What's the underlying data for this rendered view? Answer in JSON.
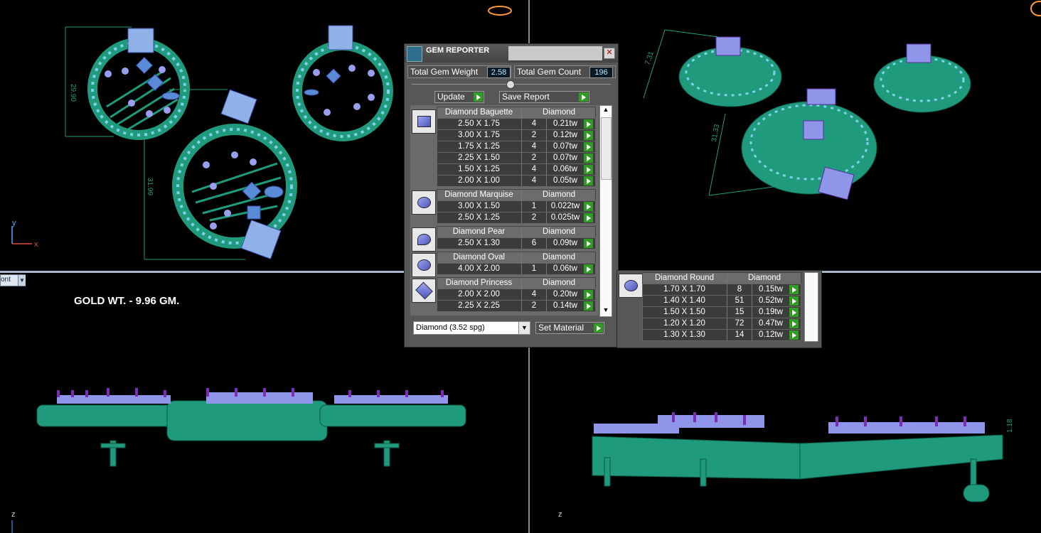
{
  "viewports": {
    "top_left": {
      "dim_vertical_1": "29.90",
      "dim_vertical_2": "31.99",
      "axis_y": "y",
      "axis_x": "x"
    },
    "top_right": {
      "dim_1": "7.31",
      "dim_2": "31.33"
    },
    "bottom_left": {
      "gold_weight": "GOLD WT. - 9.96 GM.",
      "view_dropdown": "ont",
      "axis_z": "z"
    },
    "bottom_right": {
      "dim_height": "1.18",
      "axis_z": "z"
    }
  },
  "gem_reporter": {
    "title": "GEM REPORTER",
    "close_label": "✕",
    "total_gem_weight_label": "Total Gem Weight",
    "total_gem_weight": "2.58",
    "total_gem_count_label": "Total Gem Count",
    "total_gem_count": "196",
    "update_label": "Update",
    "save_report_label": "Save Report",
    "groups": [
      {
        "name": "Diamond Baguette",
        "material": "Diamond",
        "rows": [
          {
            "size": "2.50 X 1.75",
            "count": "4",
            "weight": "0.21tw"
          },
          {
            "size": "3.00 X 1.75",
            "count": "2",
            "weight": "0.12tw"
          },
          {
            "size": "1.75 X 1.25",
            "count": "4",
            "weight": "0.07tw"
          },
          {
            "size": "2.25 X 1.50",
            "count": "2",
            "weight": "0.07tw"
          },
          {
            "size": "1.50 X 1.25",
            "count": "4",
            "weight": "0.06tw"
          },
          {
            "size": "2.00 X 1.00",
            "count": "4",
            "weight": "0.05tw"
          }
        ]
      },
      {
        "name": "Diamond Marquise",
        "material": "Diamond",
        "rows": [
          {
            "size": "3.00 X 1.50",
            "count": "1",
            "weight": "0.022tw"
          },
          {
            "size": "2.50 X 1.25",
            "count": "2",
            "weight": "0.025tw"
          }
        ]
      },
      {
        "name": "Diamond Pear",
        "material": "Diamond",
        "rows": [
          {
            "size": "2.50 X 1.30",
            "count": "6",
            "weight": "0.09tw"
          }
        ]
      },
      {
        "name": "Diamond Oval",
        "material": "Diamond",
        "rows": [
          {
            "size": "4.00 X 2.00",
            "count": "1",
            "weight": "0.06tw"
          }
        ]
      },
      {
        "name": "Diamond Princess",
        "material": "Diamond",
        "rows": [
          {
            "size": "2.00 X 2.00",
            "count": "4",
            "weight": "0.20tw"
          },
          {
            "size": "2.25 X 2.25",
            "count": "2",
            "weight": "0.14tw"
          }
        ]
      }
    ],
    "material_select": "Diamond     (3.52 spg)",
    "set_material_label": "Set Material"
  },
  "round_panel": {
    "name": "Diamond Round",
    "material": "Diamond",
    "rows": [
      {
        "size": "1.70 X 1.70",
        "count": "8",
        "weight": "0.15tw"
      },
      {
        "size": "1.40 X 1.40",
        "count": "51",
        "weight": "0.52tw"
      },
      {
        "size": "1.50 X 1.50",
        "count": "15",
        "weight": "0.19tw"
      },
      {
        "size": "1.20 X 1.20",
        "count": "72",
        "weight": "0.47tw"
      },
      {
        "size": "1.30 X 1.30",
        "count": "14",
        "weight": "0.12tw"
      }
    ]
  }
}
